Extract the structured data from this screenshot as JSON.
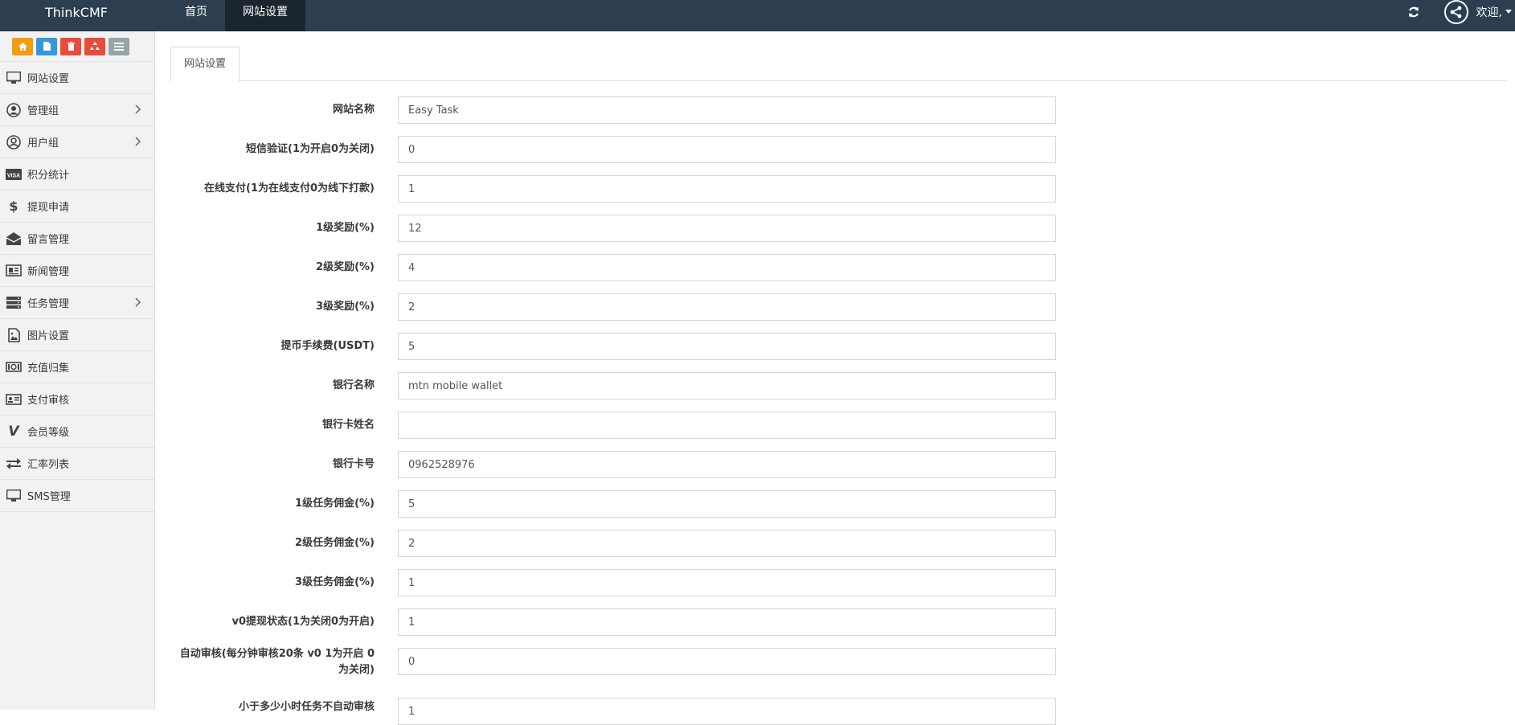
{
  "topbar": {
    "brand": "ThinkCMF",
    "nav": [
      {
        "label": "首页"
      },
      {
        "label": "网站设置"
      }
    ],
    "welcome": "欢迎,"
  },
  "sidebar": {
    "shortcut_colors": [
      "#f39c12",
      "#3498db",
      "#e74c3c",
      "#e74c3c",
      "#95a5a6"
    ],
    "items": [
      {
        "label": "网站设置",
        "icon": "monitor-icon"
      },
      {
        "label": "管理组",
        "icon": "user-circle-icon"
      },
      {
        "label": "用户组",
        "icon": "user-icon"
      },
      {
        "label": "积分统计",
        "icon": "visa-card-icon"
      },
      {
        "label": "提现申请",
        "icon": "dollar-icon"
      },
      {
        "label": "留言管理",
        "icon": "envelope-open-icon"
      },
      {
        "label": "新闻管理",
        "icon": "newspaper-icon"
      },
      {
        "label": "任务管理",
        "icon": "server-icon"
      },
      {
        "label": "图片设置",
        "icon": "image-file-icon"
      },
      {
        "label": "充值归集",
        "icon": "money-icon"
      },
      {
        "label": "支付审核",
        "icon": "id-card-icon"
      },
      {
        "label": "会员等级",
        "icon": "vine-icon"
      },
      {
        "label": "汇率列表",
        "icon": "exchange-icon"
      },
      {
        "label": "SMS管理",
        "icon": "monitor-icon"
      }
    ]
  },
  "tabs": [
    {
      "label": "网站设置"
    }
  ],
  "form": {
    "rows": [
      {
        "label": "网站名称",
        "value": "Easy Task"
      },
      {
        "label": "短信验证(1为开启0为关闭)",
        "value": "0"
      },
      {
        "label": "在线支付(1为在线支付0为线下打款)",
        "value": "1"
      },
      {
        "label": "1级奖励(%)",
        "value": "12"
      },
      {
        "label": "2级奖励(%)",
        "value": "4"
      },
      {
        "label": "3级奖励(%)",
        "value": "2"
      },
      {
        "label": "提币手续费(USDT)",
        "value": "5"
      },
      {
        "label": "银行名称",
        "value": "mtn mobile wallet"
      },
      {
        "label": "银行卡姓名",
        "value": ""
      },
      {
        "label": "银行卡号",
        "value": "0962528976"
      },
      {
        "label": "1级任务佣金(%)",
        "value": "5"
      },
      {
        "label": "2级任务佣金(%)",
        "value": "2"
      },
      {
        "label": "3级任务佣金(%)",
        "value": "1"
      },
      {
        "label": "v0提现状态(1为关闭0为开启)",
        "value": "1"
      },
      {
        "label": "自动审核(每分钟审核20条 v0 1为开启 0为关闭)",
        "value": "0"
      },
      {
        "label": "小于多少小时任务不自动审核",
        "value": "1"
      }
    ]
  }
}
